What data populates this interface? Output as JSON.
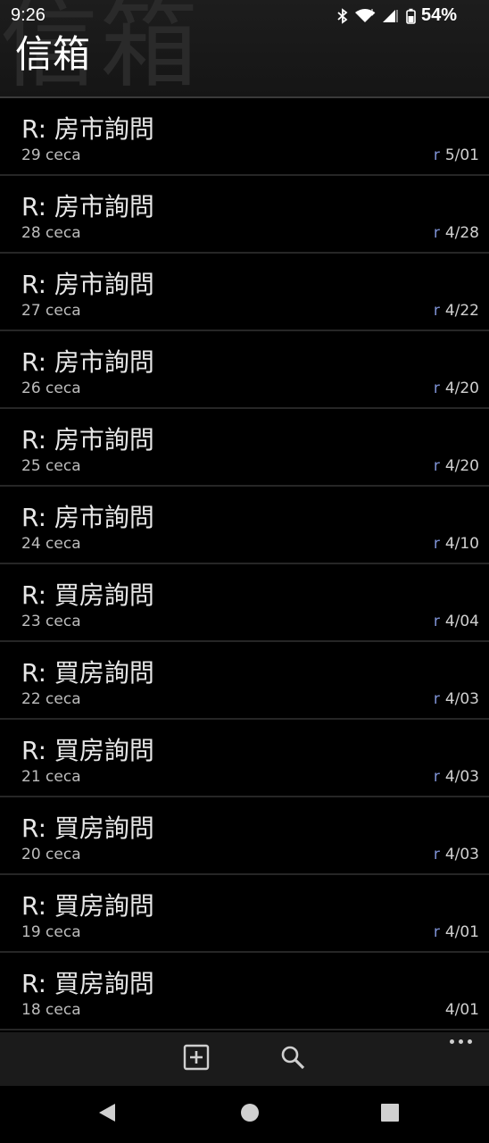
{
  "status": {
    "time": "9:26",
    "battery": "54%"
  },
  "header": {
    "title": "信箱",
    "watermark": "信箱"
  },
  "messages": [
    {
      "subject": "R: 房市詢問",
      "count": "29 ceca",
      "flag": "r",
      "date": "5/01"
    },
    {
      "subject": "R: 房市詢問",
      "count": "28 ceca",
      "flag": "r",
      "date": "4/28"
    },
    {
      "subject": "R: 房市詢問",
      "count": "27 ceca",
      "flag": "r",
      "date": "4/22"
    },
    {
      "subject": "R: 房市詢問",
      "count": "26 ceca",
      "flag": "r",
      "date": "4/20"
    },
    {
      "subject": "R: 房市詢問",
      "count": "25 ceca",
      "flag": "r",
      "date": "4/20"
    },
    {
      "subject": "R: 房市詢問",
      "count": "24 ceca",
      "flag": "r",
      "date": "4/10"
    },
    {
      "subject": "R: 買房詢問",
      "count": "23 ceca",
      "flag": "r",
      "date": "4/04"
    },
    {
      "subject": "R: 買房詢問",
      "count": "22 ceca",
      "flag": "r",
      "date": "4/03"
    },
    {
      "subject": "R: 買房詢問",
      "count": "21 ceca",
      "flag": "r",
      "date": "4/03"
    },
    {
      "subject": "R: 買房詢問",
      "count": "20 ceca",
      "flag": "r",
      "date": "4/03"
    },
    {
      "subject": "R: 買房詢問",
      "count": "19 ceca",
      "flag": "r",
      "date": "4/01"
    },
    {
      "subject": "R: 買房詢問",
      "count": "18 ceca",
      "flag": "",
      "date": "4/01"
    }
  ],
  "toolbar": {
    "compose_icon": "add-box-icon",
    "search_icon": "search-icon",
    "more_icon": "more-horizontal-icon"
  },
  "navbar": {
    "back_icon": "back-triangle-icon",
    "home_icon": "home-circle-icon",
    "recents_icon": "recents-square-icon"
  },
  "colors": {
    "background": "#000000",
    "flag": "#7f93d6",
    "divider": "#262626"
  }
}
